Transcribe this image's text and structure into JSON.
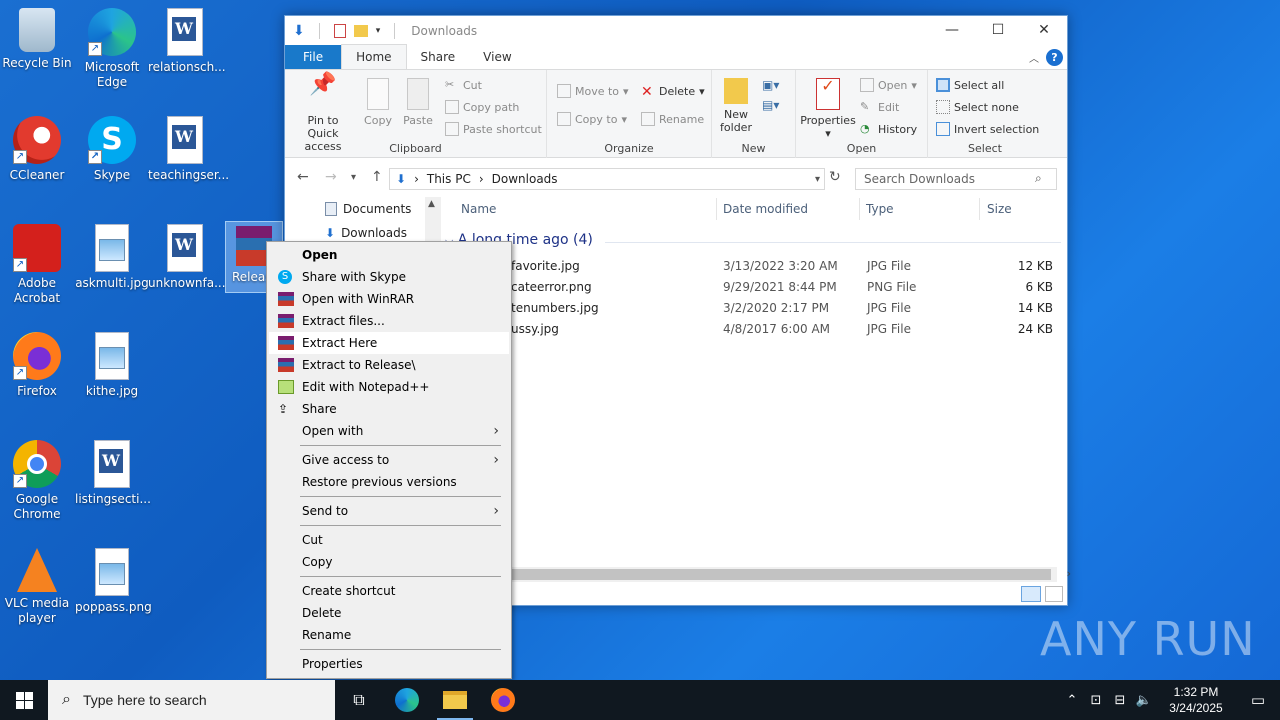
{
  "desktop": {
    "icons": [
      {
        "label": "Recycle Bin"
      },
      {
        "label": "Microsoft Edge"
      },
      {
        "label": "relationsch..."
      },
      {
        "label": "CCleaner"
      },
      {
        "label": "Skype"
      },
      {
        "label": "teachingser..."
      },
      {
        "label": "Adobe Acrobat"
      },
      {
        "label": "askmulti.jpg"
      },
      {
        "label": "unknownfa..."
      },
      {
        "label": "Releas"
      },
      {
        "label": "Firefox"
      },
      {
        "label": "kithe.jpg"
      },
      {
        "label": "Google Chrome"
      },
      {
        "label": "listingsecti..."
      },
      {
        "label": "VLC media player"
      },
      {
        "label": "poppass.png"
      }
    ]
  },
  "explorer": {
    "title": "Downloads",
    "tabs": [
      "File",
      "Home",
      "Share",
      "View"
    ],
    "ribbon": {
      "clipboard": {
        "pin": "Pin to Quick access",
        "copy": "Copy",
        "paste": "Paste",
        "cut": "Cut",
        "copy_path": "Copy path",
        "paste_shortcut": "Paste shortcut",
        "label": "Clipboard"
      },
      "organize": {
        "move_to": "Move to",
        "copy_to": "Copy to",
        "delete": "Delete",
        "rename": "Rename",
        "label": "Organize"
      },
      "new": {
        "new_folder": "New folder",
        "label": "New"
      },
      "open": {
        "properties": "Properties",
        "open": "Open",
        "edit": "Edit",
        "history": "History",
        "label": "Open"
      },
      "select": {
        "select_all": "Select all",
        "select_none": "Select none",
        "invert": "Invert selection",
        "label": "Select"
      }
    },
    "address": {
      "crumbs": [
        "This PC",
        "Downloads"
      ]
    },
    "search_placeholder": "Search Downloads",
    "nav": [
      "Documents",
      "Downloads"
    ],
    "columns": [
      "Name",
      "Date modified",
      "Type",
      "Size"
    ],
    "group_header": "A long time ago (4)",
    "files": [
      {
        "name": "favorite.jpg",
        "date": "3/13/2022 3:20 AM",
        "type": "JPG File",
        "size": "12 KB"
      },
      {
        "name": "cateerror.png",
        "date": "9/29/2021 8:44 PM",
        "type": "PNG File",
        "size": "6 KB"
      },
      {
        "name": "tenumbers.jpg",
        "date": "3/2/2020 2:17 PM",
        "type": "JPG File",
        "size": "14 KB"
      },
      {
        "name": "ussy.jpg",
        "date": "4/8/2017 6:00 AM",
        "type": "JPG File",
        "size": "24 KB"
      }
    ]
  },
  "context_menu": {
    "items": [
      {
        "label": "Open"
      },
      {
        "label": "Share with Skype"
      },
      {
        "label": "Open with WinRAR"
      },
      {
        "label": "Extract files..."
      },
      {
        "label": "Extract Here"
      },
      {
        "label": "Extract to Release\\"
      },
      {
        "label": "Edit with Notepad++"
      },
      {
        "label": "Share"
      },
      {
        "label": "Open with"
      },
      {
        "label": "Give access to"
      },
      {
        "label": "Restore previous versions"
      },
      {
        "label": "Send to"
      },
      {
        "label": "Cut"
      },
      {
        "label": "Copy"
      },
      {
        "label": "Create shortcut"
      },
      {
        "label": "Delete"
      },
      {
        "label": "Rename"
      },
      {
        "label": "Properties"
      }
    ]
  },
  "taskbar": {
    "search_placeholder": "Type here to search",
    "time": "1:32 PM",
    "date": "3/24/2025"
  },
  "watermark": "ANY RUN"
}
